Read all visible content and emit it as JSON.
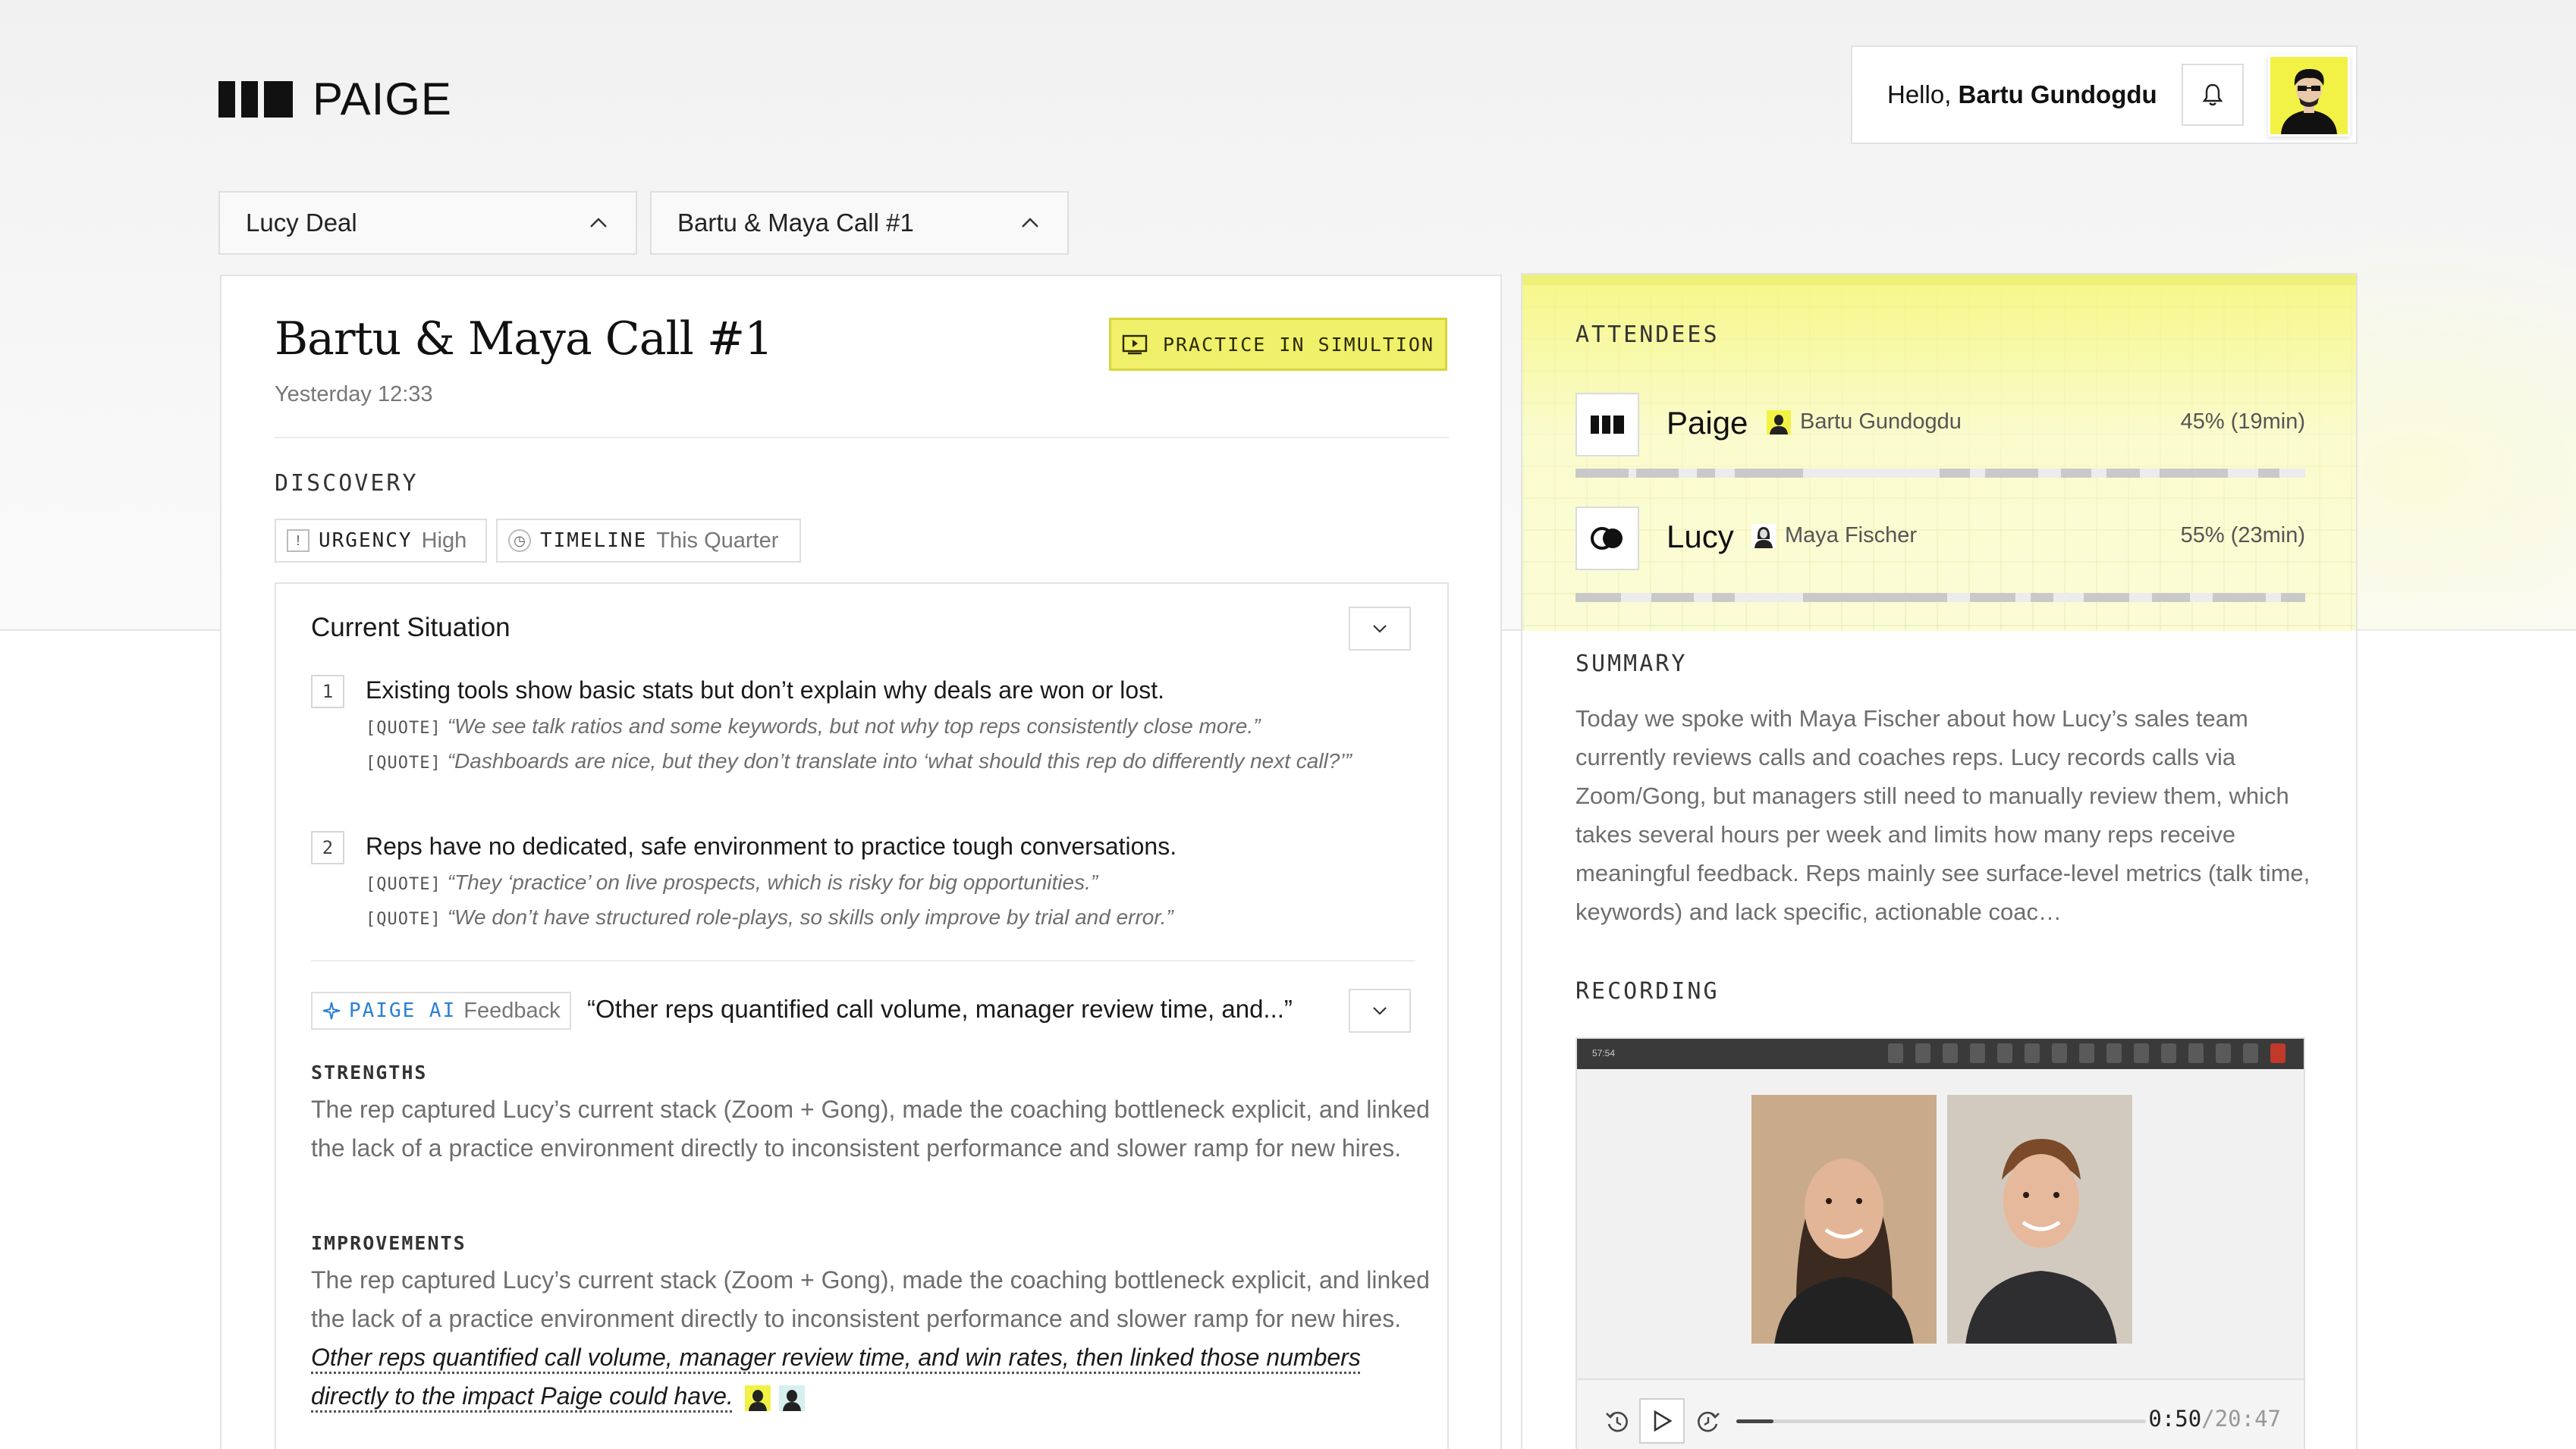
{
  "brand": {
    "name": "PAIGE"
  },
  "header": {
    "greeting_prefix": "Hello,",
    "user_name": "Bartu Gundogdu"
  },
  "selectors": {
    "deal": "Lucy Deal",
    "call": "Bartu & Maya Call #1"
  },
  "call": {
    "title": "Bartu & Maya Call #1",
    "date": "Yesterday 12:33",
    "practice_label": "PRACTICE IN SIMULTION"
  },
  "discovery": {
    "label": "DISCOVERY",
    "tags": [
      {
        "key": "URGENCY",
        "value": "High",
        "icon": "exclamation-icon"
      },
      {
        "key": "TIMELINE",
        "value": "This Quarter",
        "icon": "clock-icon"
      }
    ]
  },
  "situation": {
    "title": "Current Situation",
    "quote_key": "[QUOTE]",
    "items": [
      {
        "num": "1",
        "text": "Existing tools show basic stats but don’t explain why deals are won or lost.",
        "quotes": [
          "“We see talk ratios and some keywords, but not why top reps consistently close more.”",
          "“Dashboards are nice, but they don’t translate into ‘what should this rep do differently next call?’”"
        ]
      },
      {
        "num": "2",
        "text": "Reps have no dedicated, safe environment to practice tough conversations.",
        "quotes": [
          "“They ‘practice’ on live prospects, which is risky for big opportunities.”",
          "“We don’t have structured role-plays, so skills only improve by trial and error.”"
        ]
      }
    ]
  },
  "feedback": {
    "ai_key": "PAIGE AI",
    "ai_label": "Feedback",
    "quote": "“Other reps quantified call volume, manager review time, and...”",
    "strengths_label": "STRENGTHS",
    "strengths_text": "The rep captured Lucy’s current stack (Zoom + Gong), made the coaching bottleneck explicit, and linked the lack of a practice environment directly to inconsistent performance and slower ramp for new hires.",
    "improvements_label": "IMPROVEMENTS",
    "improvements_text": "The rep captured Lucy’s current stack (Zoom + Gong), made the coaching bottleneck explicit, and linked the lack of a practice environment directly to inconsistent performance and slower ramp for new hires.",
    "improvements_highlight": "Other reps quantified call volume, manager review time, and win rates, then linked those numbers directly to the impact Paige could have."
  },
  "attendees": {
    "label": "ATTENDEES",
    "rows": [
      {
        "company": "Paige",
        "person": "Bartu Gundogdu",
        "share": "45% (19min)",
        "talk_fraction": 0.45
      },
      {
        "company": "Lucy",
        "person": "Maya Fischer",
        "share": "55% (23min)",
        "talk_fraction": 0.55
      }
    ]
  },
  "summary": {
    "label": "SUMMARY",
    "text": "Today we spoke with Maya Fischer about how Lucy’s sales team currently reviews calls and coaches reps. Lucy records calls via Zoom/Gong, but managers still need to manually review them, which takes several hours per week and limits how many reps receive meaningful feedback. Reps mainly see surface-level metrics (talk time, keywords) and lack specific, actionable coac…"
  },
  "recording": {
    "label": "RECORDING",
    "meeting_time": "57:54",
    "current": "0:50",
    "separator": "/",
    "duration": "20:47",
    "progress_fraction": 0.09
  },
  "colors": {
    "accent_yellow": "#f0f06a",
    "ai_blue": "#2a7fd6"
  }
}
